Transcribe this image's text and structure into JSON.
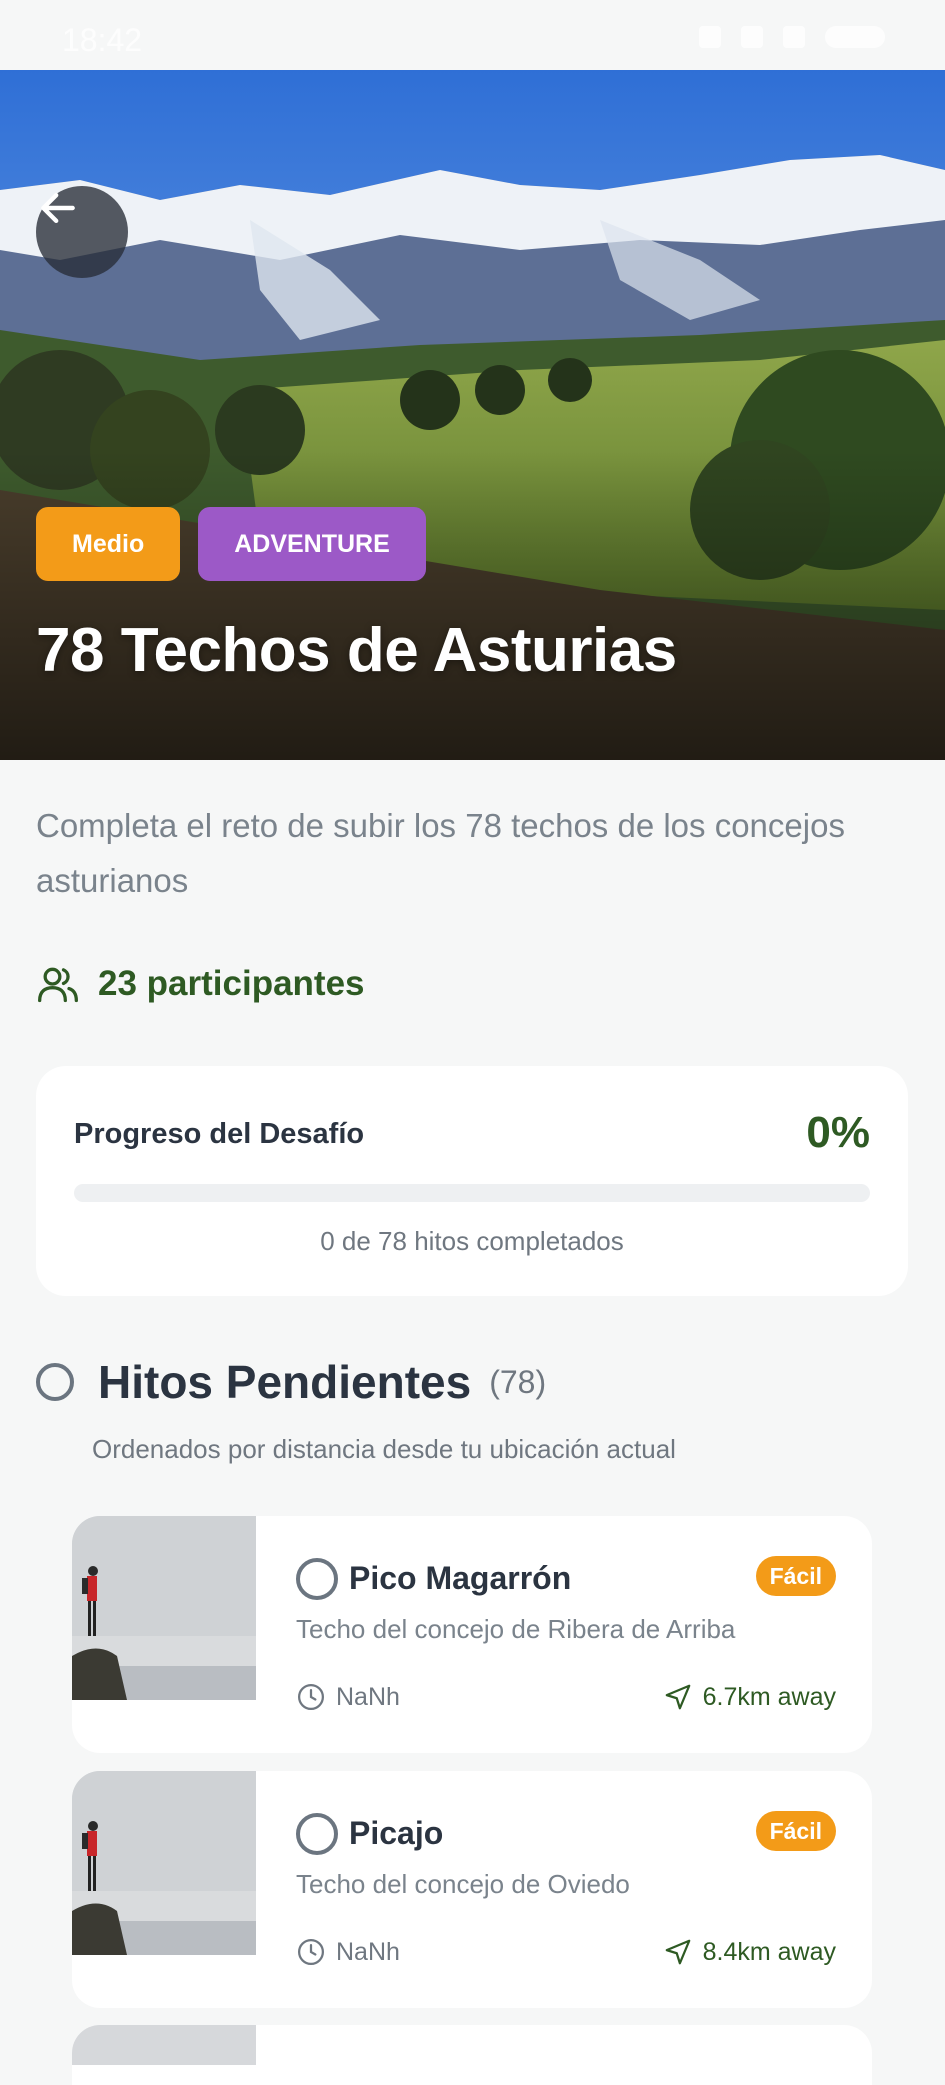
{
  "status_bar": {
    "time": "18:42"
  },
  "hero": {
    "difficulty_badge": "Medio",
    "category_badge": "ADVENTURE",
    "title": "78 Techos de Asturias"
  },
  "description": "Completa el reto de subir los 78 techos de los concejos asturianos",
  "participants": {
    "label": "23 participantes",
    "icon": "users-icon"
  },
  "progress": {
    "label": "Progreso del Desafío",
    "value_text": "0%",
    "fraction": 0,
    "subtitle": "0 de 78 hitos completados"
  },
  "pending_section": {
    "title": "Hitos Pendientes",
    "count": "(78)",
    "subtitle": "Ordenados por distancia desde tu ubicación actual"
  },
  "peaks": [
    {
      "name": "Pico Magarrón",
      "badge": "Fácil",
      "description": "Techo del concejo de Ribera de Arriba",
      "time": "NaNh",
      "distance": "6.7km away"
    },
    {
      "name": "Picajo",
      "badge": "Fácil",
      "description": "Techo del concejo de Oviedo",
      "time": "NaNh",
      "distance": "8.4km away"
    }
  ],
  "colors": {
    "accent_green": "#2e5a23",
    "difficulty_orange": "#f39b18",
    "category_purple": "#9c59c7",
    "background": "#f6f7f7"
  }
}
